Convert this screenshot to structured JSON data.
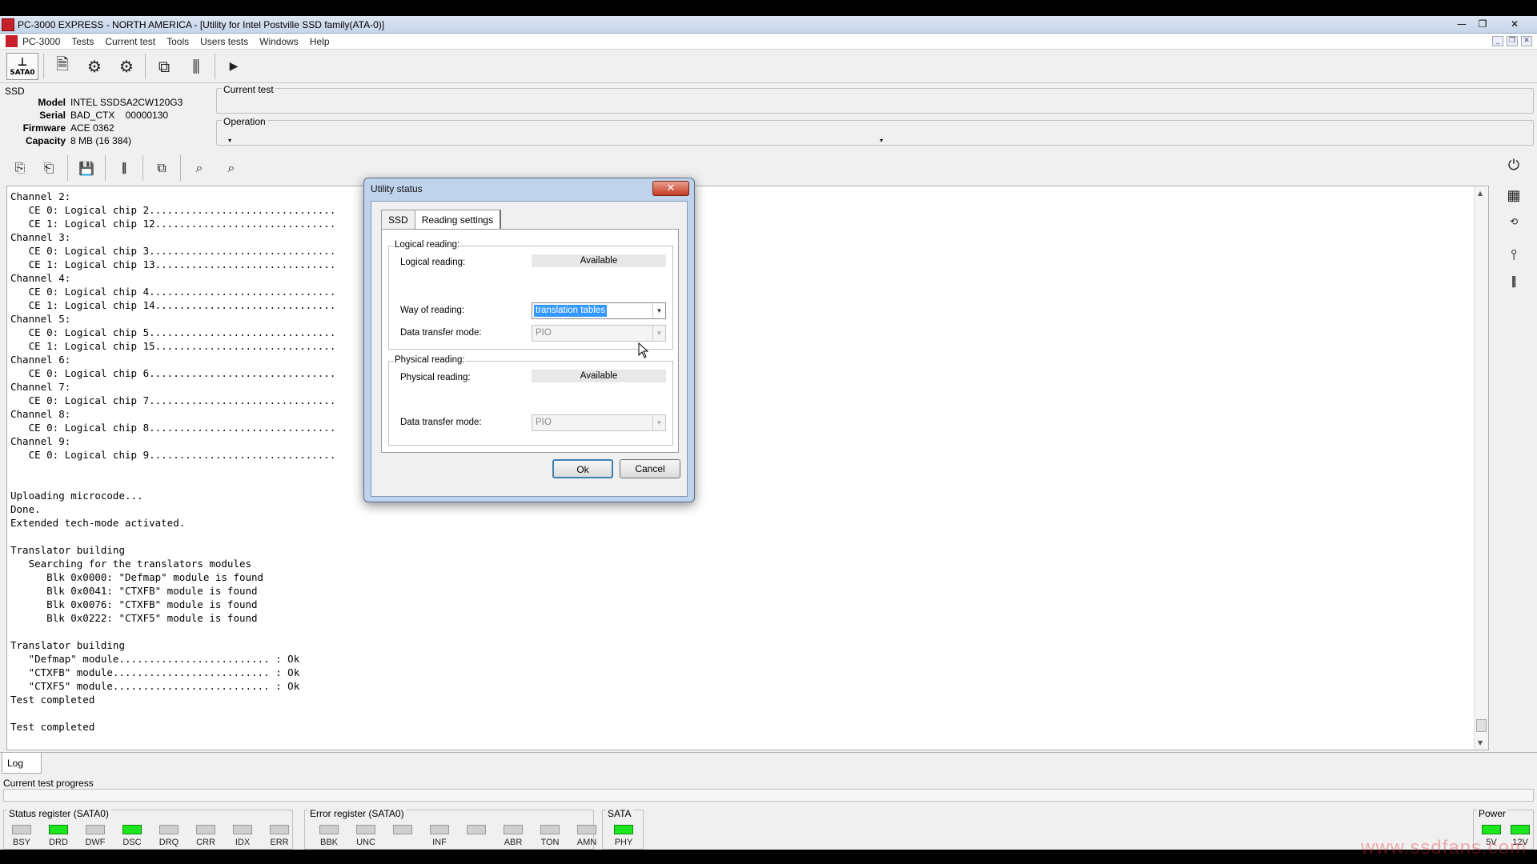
{
  "window": {
    "title": "PC-3000 EXPRESS - NORTH AMERICA - [Utility for Intel Postville SSD family(ATA-0)]"
  },
  "menu": [
    "PC-3000",
    "Tests",
    "Current test",
    "Tools",
    "Users tests",
    "Windows",
    "Help"
  ],
  "toolbar": {
    "sata_label": "SATA0"
  },
  "ssd": {
    "label": "SSD",
    "model_label": "Model",
    "model": "INTEL SSDSA2CW120G3",
    "serial_label": "Serial",
    "serial": "BAD_CTX    00000130",
    "firmware_label": "Firmware",
    "firmware": "ACE 0362",
    "capacity_label": "Capacity",
    "capacity": "8 MB (16 384)"
  },
  "current_test": {
    "label": "Current test"
  },
  "operation": {
    "label": "Operation"
  },
  "log": {
    "tab": "Log",
    "lines": "Channel 2:\n   CE 0: Logical chip 2...............................\n   CE 1: Logical chip 12..............................\nChannel 3:\n   CE 0: Logical chip 3...............................\n   CE 1: Logical chip 13..............................\nChannel 4:\n   CE 0: Logical chip 4...............................\n   CE 1: Logical chip 14..............................\nChannel 5:\n   CE 0: Logical chip 5...............................\n   CE 1: Logical chip 15..............................\nChannel 6:\n   CE 0: Logical chip 6...............................\nChannel 7:\n   CE 0: Logical chip 7...............................\nChannel 8:\n   CE 0: Logical chip 8...............................\nChannel 9:\n   CE 0: Logical chip 9...............................\n\n\nUploading microcode...\nDone.\nExtended tech-mode activated.\n\nTranslator building\n   Searching for the translators modules\n      Blk 0x0000: \"Defmap\" module is found\n      Blk 0x0041: \"CTXFB\" module is found\n      Blk 0x0076: \"CTXFB\" module is found\n      Blk 0x0222: \"CTXF5\" module is found\n\nTranslator building\n   \"Defmap\" module......................... : Ok\n   \"CTXFB\" module.......................... : Ok\n   \"CTXF5\" module.......................... : Ok\nTest completed\n\nTest completed"
  },
  "progress": {
    "label": "Current test progress"
  },
  "status_register": {
    "label": "Status register (SATA0)",
    "leds": [
      {
        "name": "BSY",
        "on": false
      },
      {
        "name": "DRD",
        "on": true
      },
      {
        "name": "DWF",
        "on": false
      },
      {
        "name": "DSC",
        "on": true
      },
      {
        "name": "DRQ",
        "on": false
      },
      {
        "name": "CRR",
        "on": false
      },
      {
        "name": "IDX",
        "on": false
      },
      {
        "name": "ERR",
        "on": false
      }
    ]
  },
  "error_register": {
    "label": "Error register (SATA0)",
    "leds": [
      {
        "name": "BBK",
        "on": false
      },
      {
        "name": "UNC",
        "on": false
      },
      {
        "name": "",
        "on": false
      },
      {
        "name": "INF",
        "on": false
      },
      {
        "name": "",
        "on": false
      },
      {
        "name": "ABR",
        "on": false
      },
      {
        "name": "TON",
        "on": false
      },
      {
        "name": "AMN",
        "on": false
      }
    ]
  },
  "sata": {
    "label": "SATA",
    "leds": [
      {
        "name": "PHY",
        "on": true
      }
    ]
  },
  "power": {
    "label": "Power",
    "leds": [
      {
        "name": "5V",
        "on": true
      },
      {
        "name": "12V",
        "on": true
      }
    ]
  },
  "watermark": "www.ssdfans.com",
  "dialog": {
    "title": "Utility status",
    "close": "✕",
    "tabs": [
      "SSD",
      "Reading settings"
    ],
    "logical": {
      "legend": "Logical reading:",
      "reading_label": "Logical reading:",
      "reading_value": "Available",
      "way_label": "Way of reading:",
      "way_value": "translation tables",
      "mode_label": "Data transfer mode:",
      "mode_value": "PIO"
    },
    "physical": {
      "legend": "Physical reading:",
      "reading_label": "Physical reading:",
      "reading_value": "Available",
      "mode_label": "Data transfer mode:",
      "mode_value": "PIO"
    },
    "ok": "Ok",
    "cancel": "Cancel"
  },
  "colors": {
    "led_on": "#1ee61e",
    "led_off": "#cfcfcf",
    "title_close": "#c43a22",
    "selection": "#3399ff"
  }
}
